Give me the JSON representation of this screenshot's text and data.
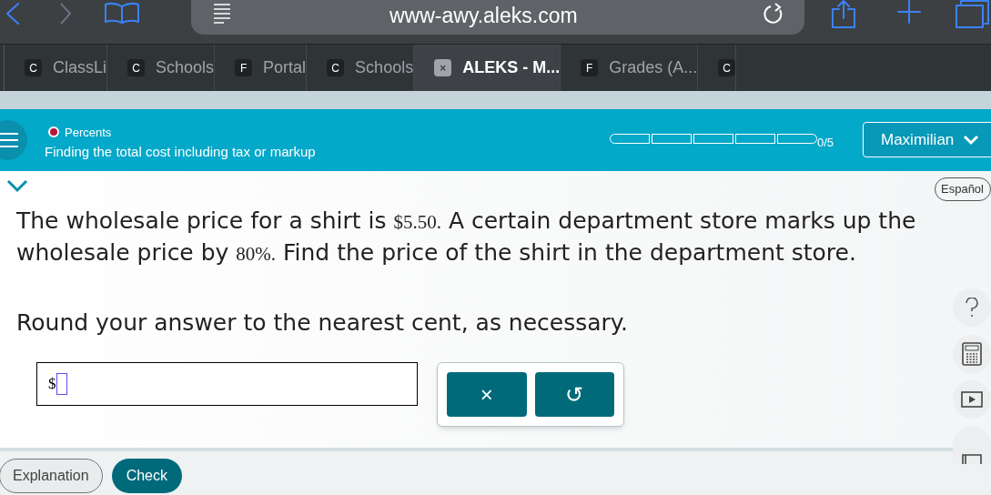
{
  "browser": {
    "url": "www-awy.aleks.com",
    "tabs": [
      {
        "icon": "C",
        "label": "ClassLi",
        "selected": false
      },
      {
        "icon": "C",
        "label": "Schools",
        "selected": false
      },
      {
        "icon": "F",
        "label": "Portal",
        "selected": false
      },
      {
        "icon": "C",
        "label": "Schools",
        "selected": false
      },
      {
        "icon": "×",
        "label": "ALEKS - M...",
        "selected": true
      },
      {
        "icon": "F",
        "label": "Grades (A...",
        "selected": false
      },
      {
        "icon": "C",
        "selected": false
      }
    ]
  },
  "header": {
    "topic": "Percents",
    "title": "Finding the total cost including tax or markup",
    "progress": {
      "reading": "0/5"
    },
    "user": "Maximilian"
  },
  "language_button": "Español",
  "question": [
    {
      "kind": "text",
      "text": "The wholesale price for a shirt is "
    },
    {
      "kind": "math",
      "text": "$5.50."
    },
    {
      "kind": "text",
      "text": " A certain department store marks up the wholesale price by "
    },
    {
      "kind": "math",
      "text": "80%."
    },
    {
      "kind": "text",
      "text": " Find the price of the shirt in the department store."
    }
  ],
  "instruction": "Round your answer to the nearest cent, as necessary.",
  "answer": {
    "prefix": "$"
  },
  "keypad": [
    "×",
    "↺"
  ],
  "footer": {
    "buttons": [
      "Explanation",
      "Check"
    ]
  }
}
